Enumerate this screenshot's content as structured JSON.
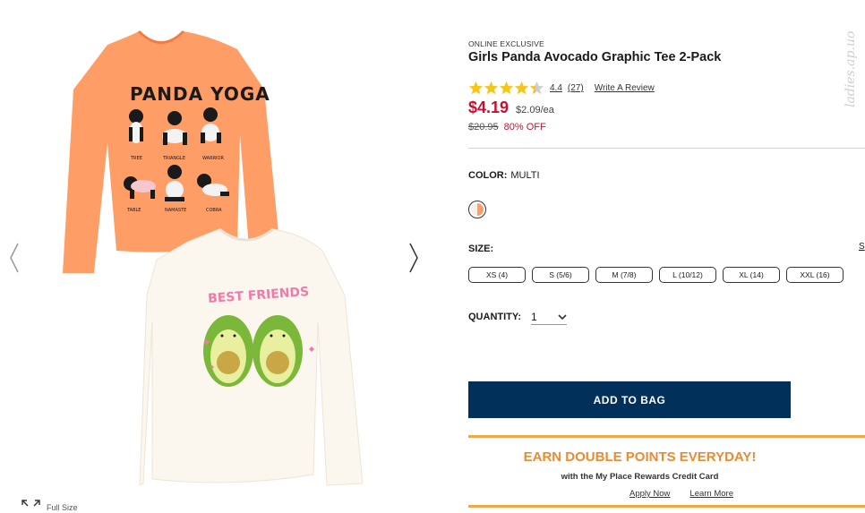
{
  "gallery": {
    "prev_icon": "chevron-left-icon",
    "next_icon": "chevron-right-icon",
    "fullsize_label": "Full Size",
    "shirt_top_text": "PANDA YOGA",
    "shirt_top_poses": [
      "TREE",
      "TRIANGLE",
      "WARRIOR",
      "TABLE",
      "NAMASTE",
      "COBRA"
    ],
    "shirt_bottom_text": "BEST FRIENDS",
    "colors": {
      "orange_shirt": "#ff9d66",
      "cream_shirt": "#fbf6ee"
    }
  },
  "product": {
    "badge": "ONLINE EXCLUSIVE",
    "title": "Girls Panda Avocado Graphic Tee 2-Pack",
    "rating_value": "4.4",
    "rating_stars": 4.4,
    "review_count": "(27)",
    "write_review": "Write A Review",
    "price": "$4.19",
    "unit_price": "$2.09/ea",
    "was_price": "$20.95",
    "discount": "80% OFF"
  },
  "color": {
    "label": "COLOR:",
    "value": "MULTI"
  },
  "size": {
    "label": "SIZE:",
    "chart_link": "S",
    "options": [
      "XS (4)",
      "S (5/6)",
      "M (7/8)",
      "L (10/12)",
      "XL (14)",
      "XXL (16)"
    ]
  },
  "quantity": {
    "label": "QUANTITY:",
    "value": "1"
  },
  "cta": {
    "add_to_bag": "ADD TO BAG"
  },
  "promo": {
    "title": "EARN DOUBLE POINTS EVERYDAY!",
    "subtitle": "with the My Place Rewards Credit Card",
    "apply": "Apply Now",
    "learn": "Learn More"
  },
  "watermark": "ladies.ap.uo",
  "theme": {
    "price_red": "#c8102e",
    "navy": "#01305a",
    "promo_orange": "#e98b2e",
    "star_gold": "#f5c518"
  }
}
